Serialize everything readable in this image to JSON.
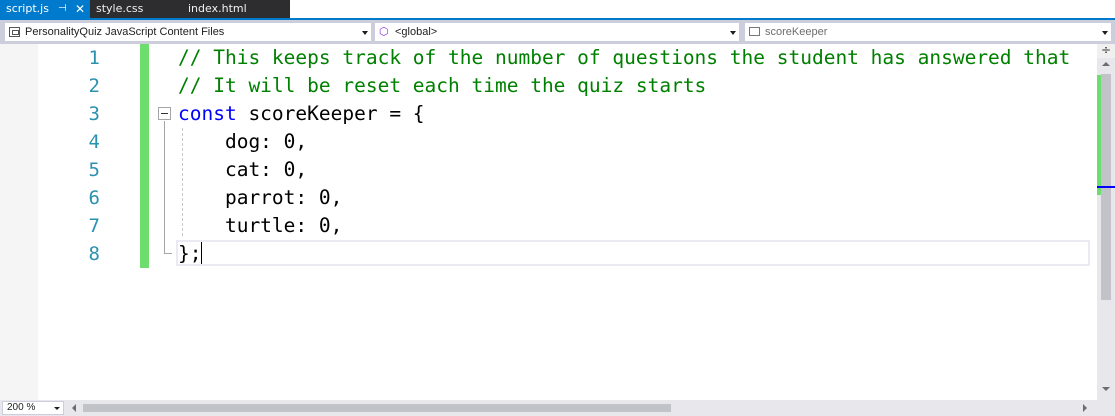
{
  "tabs": [
    {
      "label": "script.js",
      "active": true,
      "pin_icon": "pin-icon",
      "close_icon": "close-icon"
    },
    {
      "label": "style.css",
      "active": false
    },
    {
      "label": "index.html",
      "active": false
    }
  ],
  "navbar": {
    "project": "PersonalityQuiz JavaScript Content Files",
    "scope": "<global>",
    "member": "scoreKeeper"
  },
  "editor": {
    "lines": [
      {
        "num": "1",
        "text": "// This keeps track of the number of questions the student has answered that",
        "kind": "comment"
      },
      {
        "num": "2",
        "text": "// It will be reset each time the quiz starts",
        "kind": "comment"
      },
      {
        "num": "3",
        "keyword": "const",
        "text": " scoreKeeper = {",
        "kind": "code"
      },
      {
        "num": "4",
        "text": "    dog: 0,",
        "kind": "code"
      },
      {
        "num": "5",
        "text": "    cat: 0,",
        "kind": "code"
      },
      {
        "num": "6",
        "text": "    parrot: 0,",
        "kind": "code"
      },
      {
        "num": "7",
        "text": "    turtle: 0,",
        "kind": "code"
      },
      {
        "num": "8",
        "text": "};",
        "kind": "code"
      }
    ],
    "colors": {
      "comment": "#008000",
      "keyword": "#0000ff",
      "line_number": "#2b91af",
      "change_bar": "#6ddd6d",
      "accent": "#007acc"
    }
  },
  "statusbar": {
    "zoom": "200 %"
  }
}
